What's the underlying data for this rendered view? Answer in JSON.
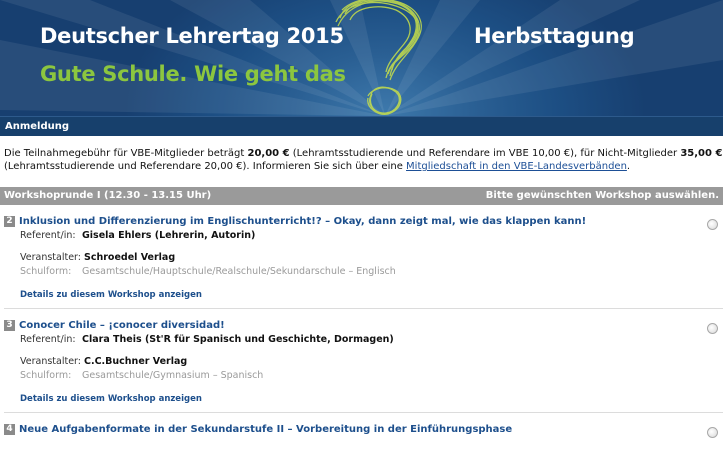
{
  "banner": {
    "title": "Deutscher Lehrertag 2015",
    "subtitle": "Gute Schule. Wie geht das",
    "right_title": "Herbsttagung"
  },
  "nav": {
    "label": "Anmeldung"
  },
  "intro": {
    "p1": "Die Teilnahmegebühr für VBE-Mitglieder beträgt ",
    "fee_member": "20,00 €",
    "p2": " (Lehramtsstudierende und Referendare im VBE 10,00 €), für Nicht-Mitglieder ",
    "fee_nonmember": "35,00 €",
    "p3": "(Lehramtsstudierende und Referendare 20,00 €). Informieren Sie sich über eine ",
    "link": "Mitgliedschaft in den VBE-Landesverbänden",
    "p4": "."
  },
  "round": {
    "label": "Workshoprunde I (12.30 - 13.15 Uhr)",
    "hint": "Bitte gewünschten Workshop auswählen."
  },
  "labels": {
    "referent": "Referent/in:",
    "veranstalter": "Veranstalter:",
    "schulform": "Schulform:",
    "details": "Details zu diesem Workshop anzeigen"
  },
  "workshops": [
    {
      "number": "2",
      "title": "Inklusion und Differenzierung im Englischunterricht!? – Okay, dann zeigt mal, wie das klappen kann!",
      "referent": "Gisela Ehlers (Lehrerin, Autorin)",
      "veranstalter": "Schroedel Verlag",
      "schulform": "Gesamtschule/Hauptschule/Realschule/Sekundarschule – Englisch"
    },
    {
      "number": "3",
      "title": "Conocer Chile – ¡conocer diversidad!",
      "referent": "Clara Theis (St'R für Spanisch und Geschichte, Dormagen)",
      "veranstalter": "C.C.Buchner Verlag",
      "schulform": "Gesamtschule/Gymnasium – Spanisch"
    },
    {
      "number": "4",
      "title": "Neue Aufgabenformate in der Sekundarstufe II – Vorbereitung in der Einführungsphase"
    }
  ],
  "colors": {
    "banner_blue": "#1d4f84",
    "nav_blue": "#17406c",
    "accent_green": "#8cc63f",
    "link_blue": "#1d4f8c",
    "round_gray": "#9a9a9a"
  }
}
